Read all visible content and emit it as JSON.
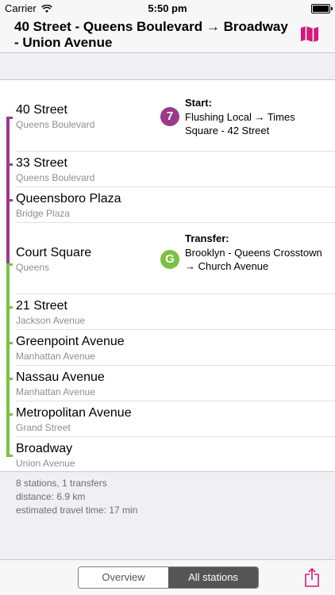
{
  "status_bar": {
    "carrier": "Carrier",
    "time": "5:50 pm"
  },
  "nav": {
    "title": "40 Street - Queens Boulevard → Broadway - Union Avenue",
    "map_icon": "map-icon"
  },
  "colors": {
    "line_7": "#9c3a8a",
    "line_g": "#7cc142",
    "accent": "#d6197c"
  },
  "stations": [
    {
      "name": "40 Street",
      "sub": "Queens Boulevard"
    },
    {
      "name": "33 Street",
      "sub": "Queens Boulevard"
    },
    {
      "name": "Queensboro Plaza",
      "sub": "Bridge Plaza"
    },
    {
      "name": "Court Square",
      "sub": "Queens"
    },
    {
      "name": "21 Street",
      "sub": "Jackson Avenue"
    },
    {
      "name": "Greenpoint Avenue",
      "sub": "Manhattan Avenue"
    },
    {
      "name": "Nassau Avenue",
      "sub": "Manhattan Avenue"
    },
    {
      "name": "Metropolitan Avenue",
      "sub": "Grand Street"
    },
    {
      "name": "Broadway",
      "sub": "Union Avenue"
    }
  ],
  "start": {
    "badge": "7",
    "label": "Start:",
    "text": "Flushing Local → Times Square - 42 Street"
  },
  "transfer": {
    "badge": "G",
    "label": "Transfer:",
    "text": "Brooklyn - Queens Crosstown → Church Avenue"
  },
  "summary": {
    "line1": "8 stations, 1 transfers",
    "line2": "distance: 6.9 km",
    "line3": "estimated travel time: 17 min"
  },
  "toolbar": {
    "overview": "Overview",
    "all_stations": "All stations",
    "selected": "All stations"
  }
}
